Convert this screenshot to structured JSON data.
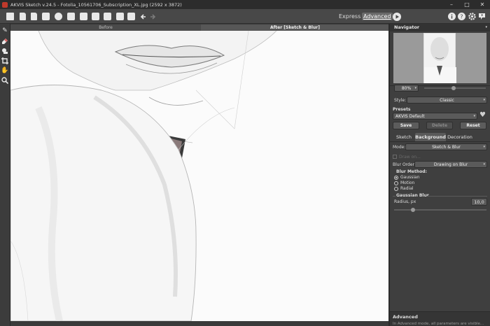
{
  "window": {
    "title": "AKVIS Sketch v.24.5 - Fotolia_10561706_Subscription_XL.jpg (2592 x 3872)",
    "minimize": "–",
    "maximize": "□",
    "close": "✕"
  },
  "toolbar": {
    "mode_express": "Express",
    "mode_advanced": "Advanced"
  },
  "tabs": {
    "before": "Before",
    "after": "After [Sketch & Blur]"
  },
  "navigator": {
    "title": "Navigator",
    "zoom": "80%"
  },
  "settings": {
    "style_label": "Style:",
    "style_value": "Classic",
    "presets_label": "Presets",
    "preset_value": "AKVIS Default",
    "save": "Save",
    "delete": "Delete",
    "reset": "Reset",
    "tabs": [
      "Sketch",
      "Background",
      "Decoration"
    ],
    "mode_label": "Mode:",
    "mode_value": "Sketch & Blur",
    "checkbox_label": "Draw on...",
    "blur_order_label": "Blur Order:",
    "blur_order_value": "Drawing on Blur",
    "blur_method_label": "Blur Method:",
    "methods": [
      "Gaussian",
      "Motion",
      "Radial"
    ],
    "selected_method": "Gaussian",
    "gaussian_group": "Gaussian Blur",
    "radius_label": "Radius, px",
    "radius_value": "10,0",
    "radius_level": 0.4
  },
  "advanced": {
    "title": "Advanced",
    "hint": "In Advanced mode, all parameters are visible..."
  },
  "colors": {
    "accent": "#5a5a5a",
    "panel": "#3f3f3f",
    "canvas": "#fafafa"
  }
}
